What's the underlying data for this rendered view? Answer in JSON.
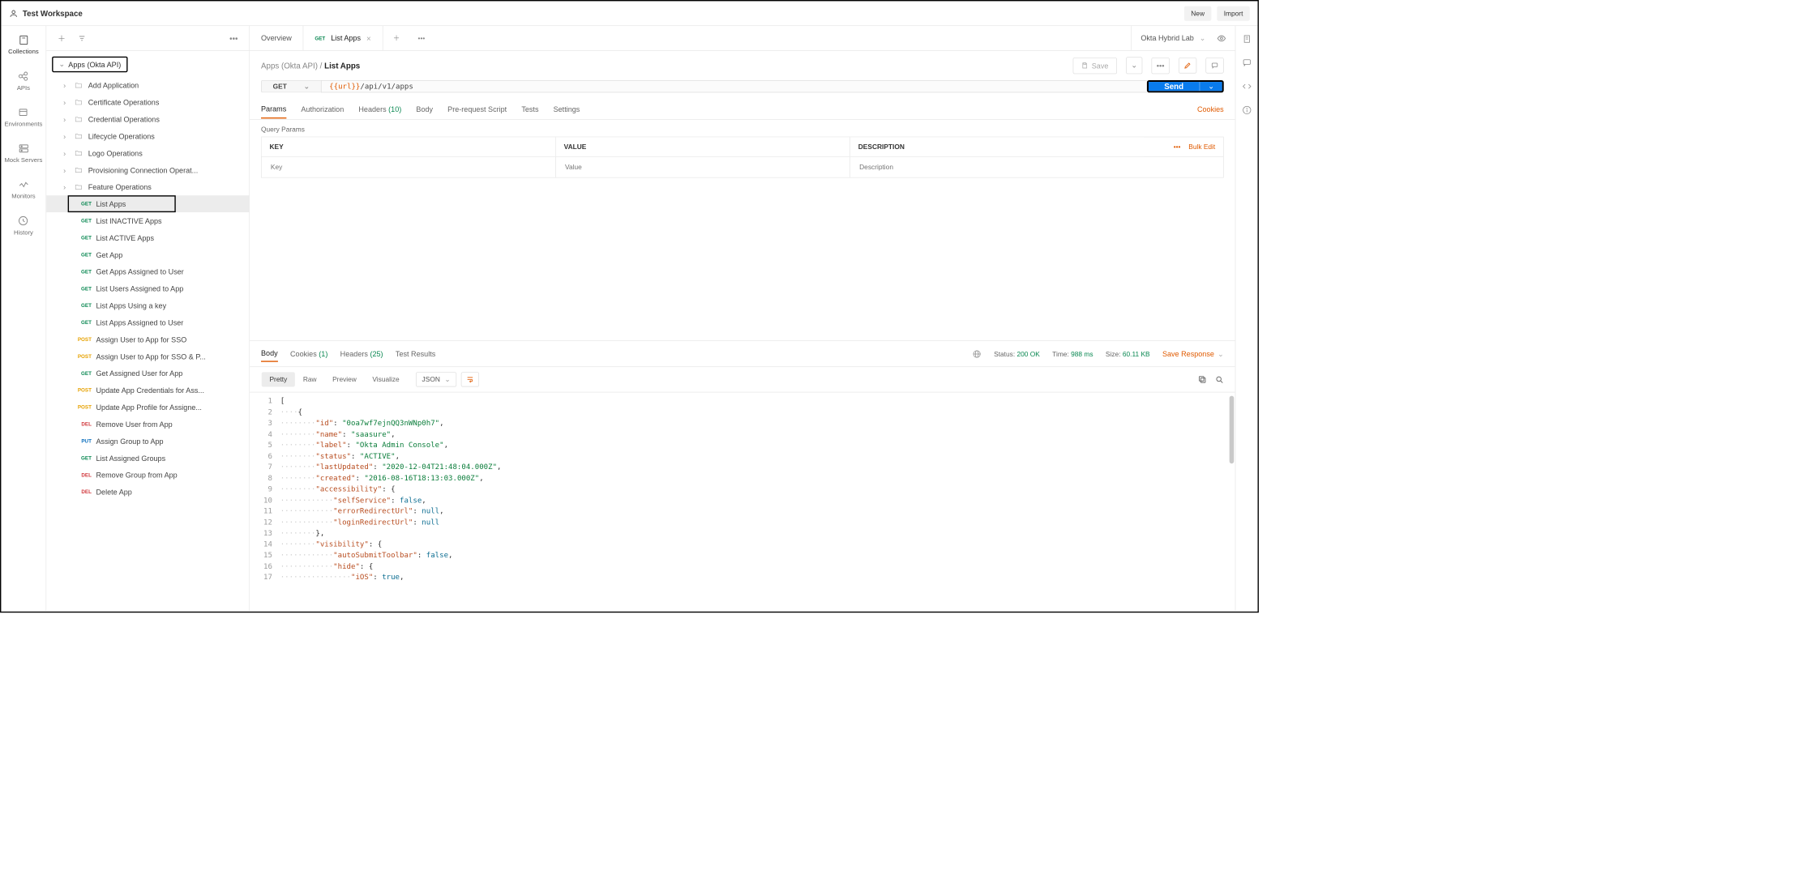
{
  "workspace": {
    "name": "Test Workspace",
    "new_btn": "New",
    "import_btn": "Import"
  },
  "rail": [
    {
      "id": "collections",
      "label": "Collections"
    },
    {
      "id": "apis",
      "label": "APIs"
    },
    {
      "id": "environments",
      "label": "Environments"
    },
    {
      "id": "mock",
      "label": "Mock Servers"
    },
    {
      "id": "monitors",
      "label": "Monitors"
    },
    {
      "id": "history",
      "label": "History"
    }
  ],
  "collection": {
    "name": "Apps (Okta API)",
    "folders": [
      "Add Application",
      "Certificate Operations",
      "Credential Operations",
      "Lifecycle Operations",
      "Logo Operations",
      "Provisioning Connection Operat...",
      "Feature Operations"
    ],
    "requests": [
      {
        "method": "GET",
        "name": "List Apps",
        "selected": true,
        "boxed": true
      },
      {
        "method": "GET",
        "name": "List INACTIVE Apps"
      },
      {
        "method": "GET",
        "name": "List ACTIVE Apps"
      },
      {
        "method": "GET",
        "name": "Get App"
      },
      {
        "method": "GET",
        "name": "Get Apps Assigned to User"
      },
      {
        "method": "GET",
        "name": "List Users Assigned to App"
      },
      {
        "method": "GET",
        "name": "List Apps Using a key"
      },
      {
        "method": "GET",
        "name": "List Apps Assigned to User"
      },
      {
        "method": "POST",
        "name": "Assign User to App for SSO"
      },
      {
        "method": "POST",
        "name": "Assign User to App for SSO & P..."
      },
      {
        "method": "GET",
        "name": "Get Assigned User for App"
      },
      {
        "method": "POST",
        "name": "Update App Credentials for Ass..."
      },
      {
        "method": "POST",
        "name": "Update App Profile for Assigne..."
      },
      {
        "method": "DEL",
        "name": "Remove User from App"
      },
      {
        "method": "PUT",
        "name": "Assign Group to App"
      },
      {
        "method": "GET",
        "name": "List Assigned Groups"
      },
      {
        "method": "DEL",
        "name": "Remove Group from App"
      },
      {
        "method": "DEL",
        "name": "Delete App"
      }
    ]
  },
  "tabs": {
    "overview": "Overview",
    "active": {
      "method": "GET",
      "label": "List Apps"
    }
  },
  "environment": "Okta Hybrid Lab",
  "breadcrumb": {
    "parent": "Apps (Okta API)",
    "current": "List Apps"
  },
  "actions": {
    "save": "Save"
  },
  "request": {
    "method": "GET",
    "url_var": "{{url}}",
    "url_path": "/api/v1/apps",
    "send": "Send"
  },
  "req_tabs": {
    "params": "Params",
    "auth": "Authorization",
    "headers": "Headers",
    "headers_count": "(10)",
    "body": "Body",
    "pre": "Pre-request Script",
    "tests": "Tests",
    "settings": "Settings",
    "cookies": "Cookies"
  },
  "query": {
    "section": "Query Params",
    "h_key": "KEY",
    "h_val": "VALUE",
    "h_desc": "DESCRIPTION",
    "ph_key": "Key",
    "ph_val": "Value",
    "ph_desc": "Description",
    "bulk": "Bulk Edit"
  },
  "response": {
    "tabs": {
      "body": "Body",
      "cookies": "Cookies",
      "cookies_n": "(1)",
      "headers": "Headers",
      "headers_n": "(25)",
      "tests": "Test Results"
    },
    "status_label": "Status:",
    "status_val": "200 OK",
    "time_label": "Time:",
    "time_val": "988 ms",
    "size_label": "Size:",
    "size_val": "60.11 KB",
    "save": "Save Response",
    "view": {
      "pretty": "Pretty",
      "raw": "Raw",
      "preview": "Preview",
      "visualize": "Visualize",
      "fmt": "JSON"
    },
    "code": [
      "[",
      "    {",
      "        \"id\": \"0oa7wf7ejnQQ3nWNp0h7\",",
      "        \"name\": \"saasure\",",
      "        \"label\": \"Okta Admin Console\",",
      "        \"status\": \"ACTIVE\",",
      "        \"lastUpdated\": \"2020-12-04T21:48:04.000Z\",",
      "        \"created\": \"2016-08-16T18:13:03.000Z\",",
      "        \"accessibility\": {",
      "            \"selfService\": false,",
      "            \"errorRedirectUrl\": null,",
      "            \"loginRedirectUrl\": null",
      "        },",
      "        \"visibility\": {",
      "            \"autoSubmitToolbar\": false,",
      "            \"hide\": {",
      "                \"iOS\": true,"
    ]
  }
}
